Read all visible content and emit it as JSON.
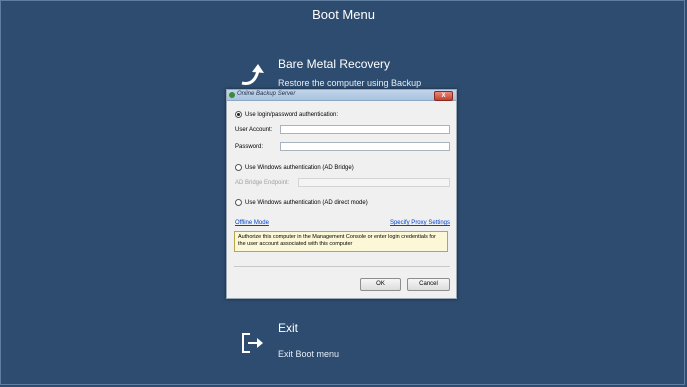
{
  "screen": {
    "title": "Boot Menu",
    "options": [
      {
        "icon": "restore-arrow-icon",
        "title": "Bare Metal Recovery",
        "subtitle": "Restore the computer using Backup"
      },
      {
        "icon": "exit-icon",
        "title": "Exit",
        "subtitle": "Exit Boot menu"
      }
    ]
  },
  "dialog": {
    "title": "Online Backup Server",
    "close_label": "X",
    "auth_login_label": "Use login/password authentication:",
    "user_account_label": "User Account:",
    "user_account_value": "",
    "password_label": "Password:",
    "password_value": "",
    "auth_windows_adbridge_label": "Use Windows authentication (AD Bridge)",
    "ad_bridge_endpoint_label": "AD Bridge Endpoint:",
    "ad_bridge_endpoint_value": "",
    "auth_windows_direct_label": "Use Windows authentication (AD direct mode)",
    "offline_mode_label": "Offline Mode",
    "proxy_settings_label": "Specify Proxy Settings",
    "info_text": "Authorize this computer in the Management Console or enter login credentials for the user account associated with this computer",
    "ok_label": "OK",
    "cancel_label": "Cancel",
    "selected_auth": "login"
  },
  "colors": {
    "background": "#2d4c6f",
    "dialog_bg": "#f0f0f0",
    "link": "#0044cc",
    "info_bg": "#fbf7d7"
  }
}
